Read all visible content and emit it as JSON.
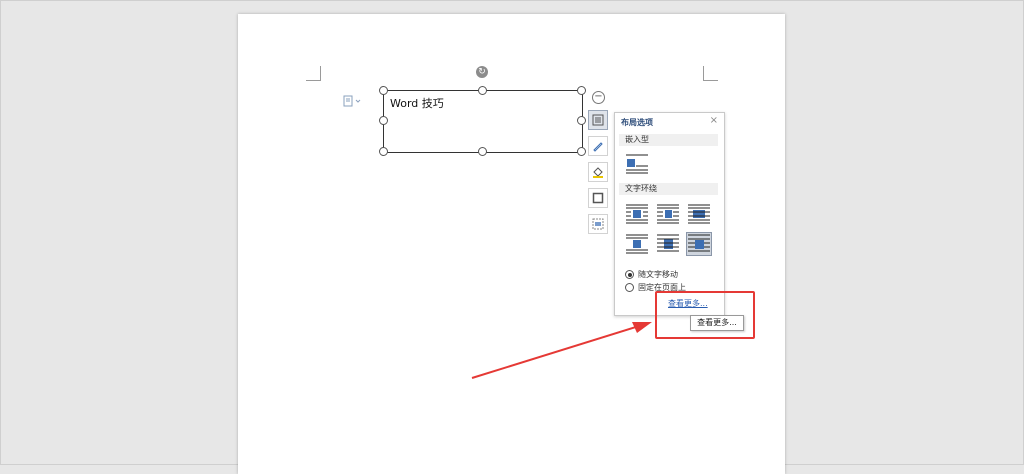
{
  "document": {
    "textbox_text": "Word 技巧"
  },
  "layout_panel": {
    "title": "布局选项",
    "close_label": "×",
    "section_inline": "嵌入型",
    "section_wrap": "文字环绕",
    "radio_options": [
      {
        "label": "随文字移动",
        "checked": true
      },
      {
        "label": "固定在页面上",
        "checked": false
      }
    ],
    "see_more": "查看更多..."
  },
  "tooltip": {
    "text": "查看更多..."
  },
  "side_tools": [
    {
      "name": "layout-options-icon"
    },
    {
      "name": "pen-icon"
    },
    {
      "name": "fill-bucket-icon"
    },
    {
      "name": "frame-icon"
    },
    {
      "name": "crop-image-icon"
    }
  ],
  "colors": {
    "highlight": "#e53935",
    "link": "#2a5db0",
    "icon_blue": "#3d6fb3"
  }
}
